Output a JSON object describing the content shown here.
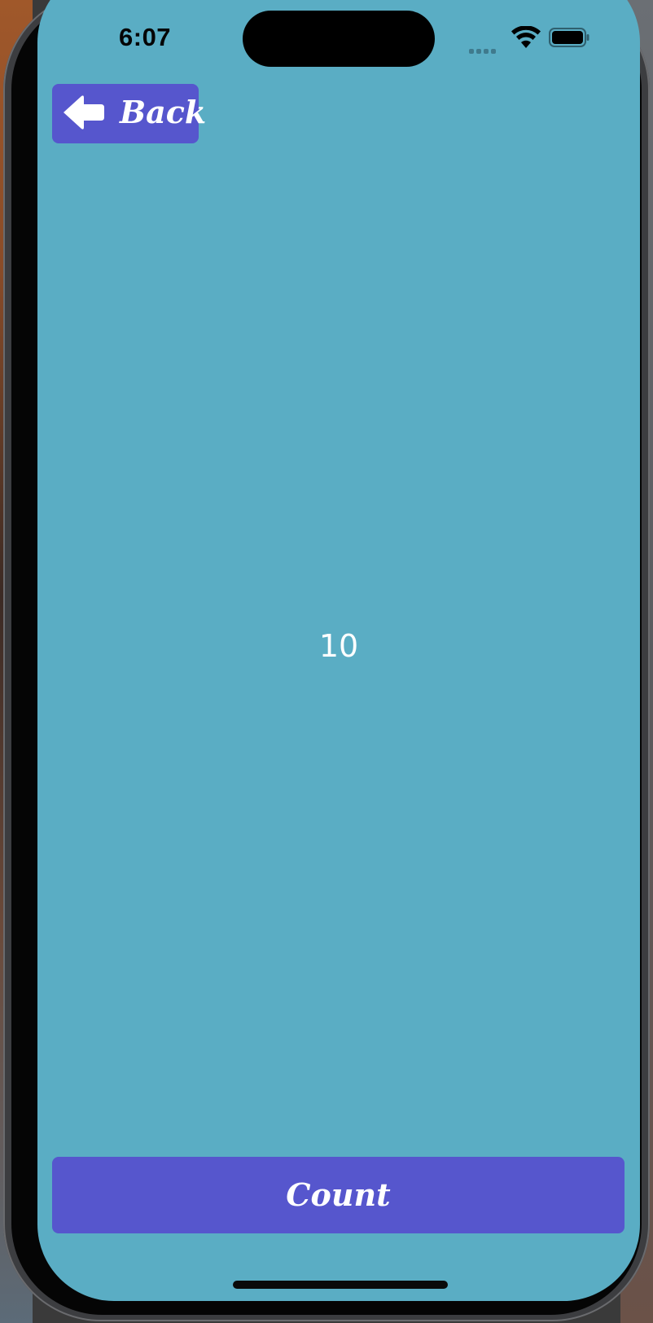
{
  "status_bar": {
    "time": "6:07",
    "icons": [
      "signal-icon",
      "wifi-icon",
      "battery-icon"
    ]
  },
  "nav": {
    "back_label": "Back",
    "back_icon": "arrow-left-icon"
  },
  "counter": {
    "value": "10"
  },
  "actions": {
    "count_label": "Count"
  },
  "colors": {
    "screen_background": "#5aadc4",
    "button_background": "#5656cd",
    "text": "#ffffff"
  }
}
